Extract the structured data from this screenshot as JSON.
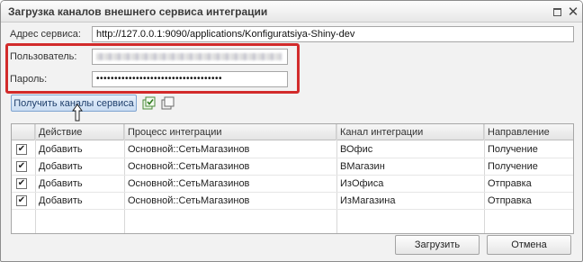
{
  "window": {
    "title": "Загрузка каналов внешнего сервиса интеграции",
    "buttons": [
      "maximize",
      "close"
    ]
  },
  "form": {
    "service_address_label": "Адрес сервиса:",
    "service_address_value": "http://127.0.0.1:9090/applications/Konfiguratsiya-Shiny-dev",
    "user_label": "Пользователь:",
    "password_label": "Пароль:",
    "password_value": "•••••••••••••••••••••••••••••••••••"
  },
  "actions": {
    "get_channels_label": "Получить каналы сервиса"
  },
  "table": {
    "columns": [
      "Действие",
      "Процесс интеграции",
      "Канал интеграции",
      "Направление"
    ],
    "rows": [
      {
        "checked": true,
        "action": "Добавить",
        "process": "Основной::СетьМагазинов",
        "channel": "ВОфис",
        "direction": "Получение"
      },
      {
        "checked": true,
        "action": "Добавить",
        "process": "Основной::СетьМагазинов",
        "channel": "ВМагазин",
        "direction": "Получение"
      },
      {
        "checked": true,
        "action": "Добавить",
        "process": "Основной::СетьМагазинов",
        "channel": "ИзОфиса",
        "direction": "Отправка"
      },
      {
        "checked": true,
        "action": "Добавить",
        "process": "Основной::СетьМагазинов",
        "channel": "ИзМагазина",
        "direction": "Отправка"
      }
    ]
  },
  "footer": {
    "load_label": "Загрузить",
    "cancel_label": "Отмена"
  },
  "colors": {
    "highlight": "#d22b2b",
    "accent_button": "#c9dcf2"
  }
}
